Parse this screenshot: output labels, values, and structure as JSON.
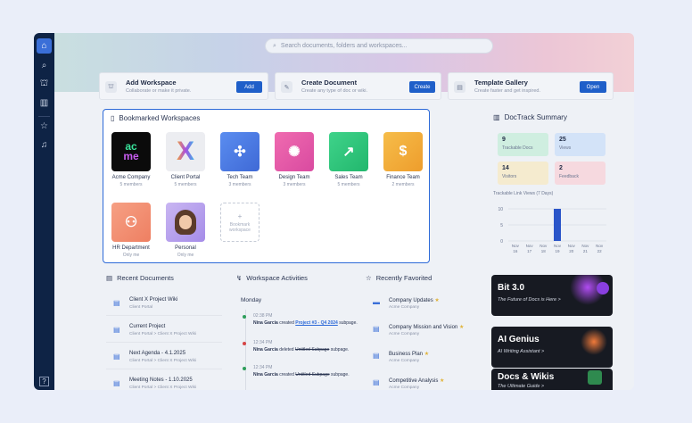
{
  "search": {
    "placeholder": "Search documents, folders and workspaces..."
  },
  "quick_actions": [
    {
      "title": "Add Workspace",
      "subtitle": "Collaborate or make it private.",
      "button": "Add"
    },
    {
      "title": "Create Document",
      "subtitle": "Create any type of doc or wiki.",
      "button": "Create"
    },
    {
      "title": "Template Gallery",
      "subtitle": "Create faster and get inspired.",
      "button": "Open"
    }
  ],
  "bookmarks": {
    "title": "Bookmarked Workspaces",
    "items": [
      {
        "name": "Acme Company",
        "count": "5 members",
        "logo": "acme"
      },
      {
        "name": "Client Portal",
        "count": "5 members",
        "logo": "X"
      },
      {
        "name": "Tech Team",
        "count": "3 members"
      },
      {
        "name": "Design Team",
        "count": "3 members"
      },
      {
        "name": "Sales Team",
        "count": "5 members"
      },
      {
        "name": "Finance Team",
        "count": "2 members"
      },
      {
        "name": "HR Department",
        "count": "Only me"
      },
      {
        "name": "Personal",
        "count": "Only me"
      }
    ],
    "add_label": "Bookmark workspace"
  },
  "summary": {
    "title": "DocTrack Summary",
    "stats": [
      {
        "value": "9",
        "label": "Trackable Docs",
        "color": "#cfeee0"
      },
      {
        "value": "25",
        "label": "Views",
        "color": "#d3e3f8"
      },
      {
        "value": "14",
        "label": "Visitors",
        "color": "#f5ebcf"
      },
      {
        "value": "2",
        "label": "Feedback",
        "color": "#f6d9df"
      }
    ],
    "chart_title": "Trackable Link Views (7 Days)"
  },
  "chart_data": {
    "type": "bar",
    "title": "Trackable Link Views (7 Days)",
    "categories": [
      "Nov 16",
      "Nov 17",
      "Nov 18",
      "Nov 19",
      "Nov 20",
      "Nov 21",
      "Nov 22"
    ],
    "values": [
      0,
      0,
      0,
      10,
      0,
      0,
      0
    ],
    "ylim": [
      0,
      10
    ],
    "yticks": [
      "10",
      "5",
      "0"
    ]
  },
  "recent_docs": {
    "title": "Recent Documents",
    "items": [
      {
        "title": "Client X Project Wiki",
        "path": "Client Portal"
      },
      {
        "title": "Current Project",
        "path": "Client Portal  >  Client X Project Wiki"
      },
      {
        "title": "Next Agenda - 4.1.2025",
        "path": "Client Portal  >  Client X Project Wiki"
      },
      {
        "title": "Meeting Notes - 1.10.2025",
        "path": "Client Portal  >  Client X Project Wiki"
      }
    ]
  },
  "activities": {
    "title": "Workspace Activities",
    "day": "Monday",
    "items": [
      {
        "time": "02:38 PM",
        "user": "Nina Garcia",
        "action": "created",
        "target": "Project #3 - Q4 2024",
        "suffix": "subpage.",
        "color": "#2e9e5b"
      },
      {
        "time": "12:34 PM",
        "user": "Nina Garcia",
        "action": "deleted",
        "target": "Untitled Subpage",
        "suffix": "subpage.",
        "color": "#d64545"
      },
      {
        "time": "12:34 PM",
        "user": "Nina Garcia",
        "action": "created",
        "target": "Untitled Subpage",
        "suffix": "subpage.",
        "color": "#2e9e5b"
      }
    ]
  },
  "favorites": {
    "title": "Recently Favorited",
    "items": [
      {
        "title": "Company Updates",
        "path": "Acme Company"
      },
      {
        "title": "Company Mission and Vision",
        "path": "Acme Company"
      },
      {
        "title": "Business Plan",
        "path": "Acme Company"
      },
      {
        "title": "Competitive Analysis",
        "path": "Acme Company"
      }
    ]
  },
  "promos": [
    {
      "title": "Bit 3.0",
      "subtitle": "The Future of Docs is Here  >"
    },
    {
      "title": "AI Genius",
      "subtitle": "AI Writing Assistant  >"
    },
    {
      "title": "Docs & Wikis",
      "subtitle": "The Ultimate Guide  >"
    }
  ]
}
